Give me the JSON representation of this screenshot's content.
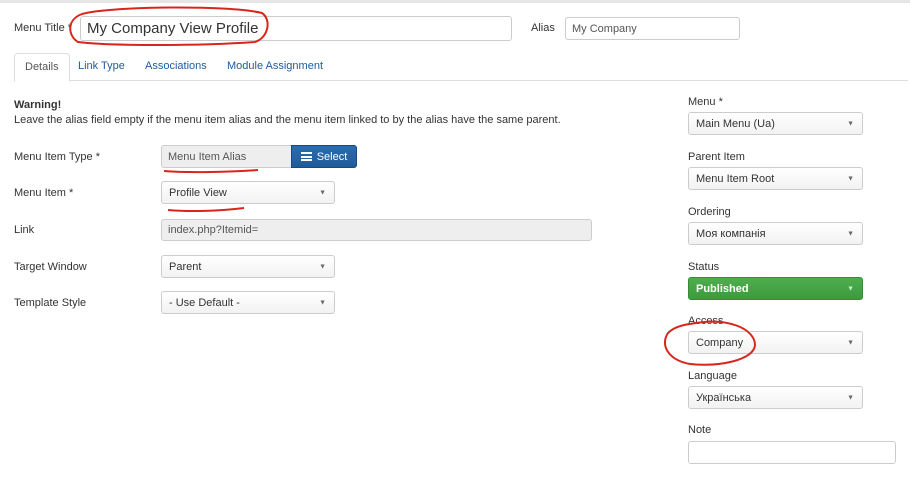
{
  "header": {
    "menu_title_label": "Menu Title *",
    "menu_title_value": "My Company View Profile",
    "alias_label": "Alias",
    "alias_value": "My Company"
  },
  "tabs": [
    {
      "label": "Details",
      "active": true
    },
    {
      "label": "Link Type",
      "active": false
    },
    {
      "label": "Associations",
      "active": false
    },
    {
      "label": "Module Assignment",
      "active": false
    }
  ],
  "warning": {
    "title": "Warning!",
    "text": "Leave the alias field empty if the menu item alias and the menu item linked to by the alias have the same parent."
  },
  "form": {
    "menu_item_type_label": "Menu Item Type *",
    "menu_item_type_value": "Menu Item Alias",
    "select_button": "Select",
    "menu_item_label": "Menu Item *",
    "menu_item_value": "Profile View",
    "link_label": "Link",
    "link_value": "index.php?Itemid=",
    "target_window_label": "Target Window",
    "target_window_value": "Parent",
    "template_style_label": "Template Style",
    "template_style_value": "- Use Default -"
  },
  "sidebar": {
    "menu_label": "Menu *",
    "menu_value": "Main Menu (Ua)",
    "parent_label": "Parent Item",
    "parent_value": "Menu Item Root",
    "ordering_label": "Ordering",
    "ordering_value": "Моя компанія",
    "status_label": "Status",
    "status_value": "Published",
    "access_label": "Access",
    "access_value": "Company",
    "language_label": "Language",
    "language_value": "Українська",
    "note_label": "Note",
    "note_value": ""
  },
  "colors": {
    "link_blue": "#1f5b9a",
    "published_green": "#46a546",
    "annotation_red": "#d9261c"
  }
}
